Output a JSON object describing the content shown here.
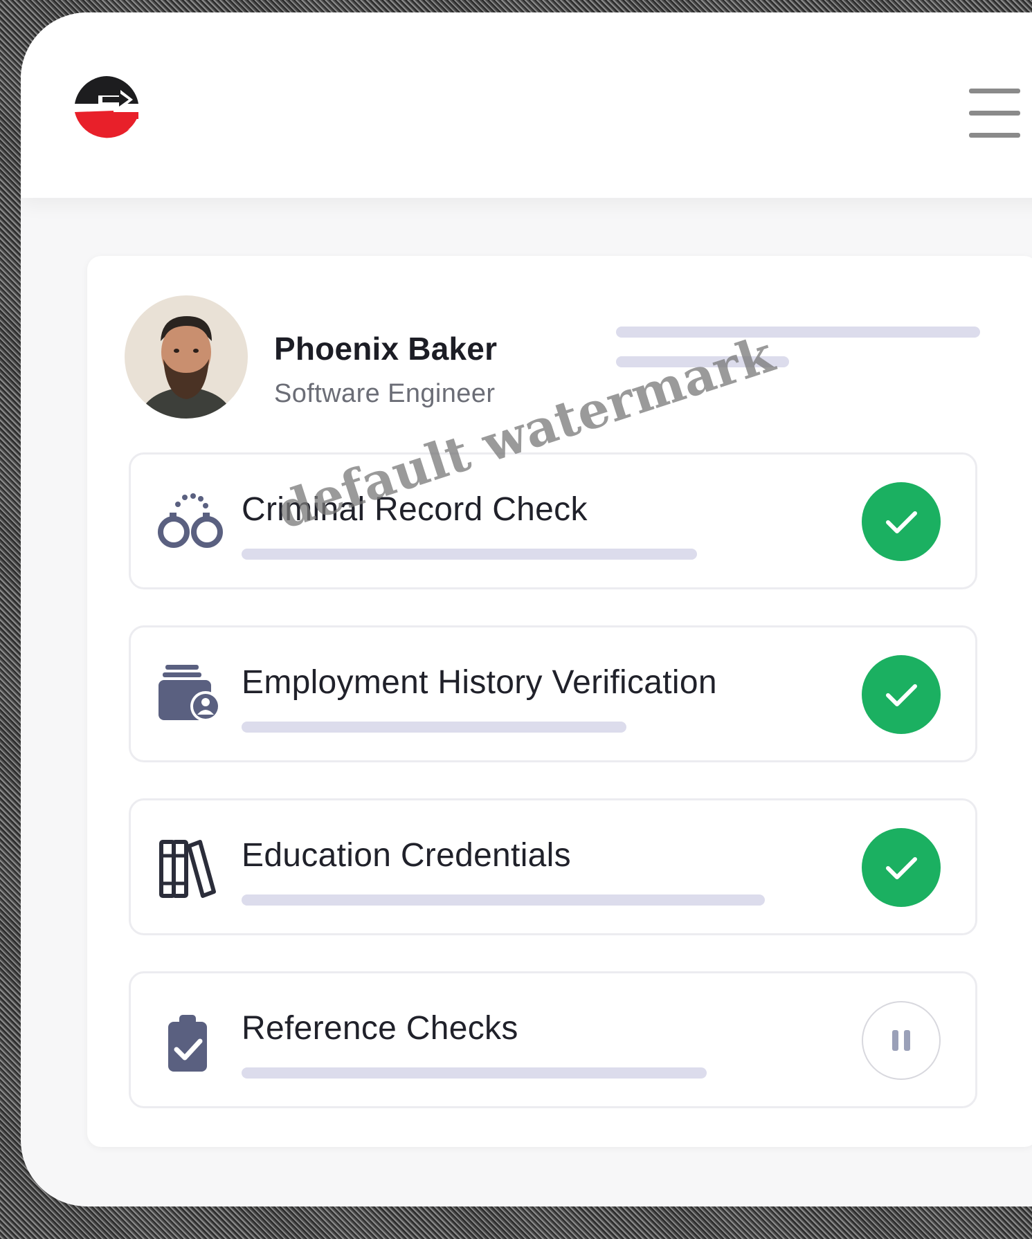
{
  "profile": {
    "name": "Phoenix Baker",
    "role": "Software Engineer"
  },
  "checks": [
    {
      "label": "Criminal Record Check",
      "icon": "handcuffs-icon",
      "status": "complete"
    },
    {
      "label": "Employment History Verification",
      "icon": "id-card-user-icon",
      "status": "complete"
    },
    {
      "label": "Education Credentials",
      "icon": "books-icon",
      "status": "complete"
    },
    {
      "label": "Reference Checks",
      "icon": "clipboard-check-icon",
      "status": "paused"
    }
  ],
  "watermark": "default watermark",
  "colors": {
    "brand_red": "#e8202a",
    "brand_dark": "#1d1d1f",
    "success": "#1bb061",
    "icon": "#5a6080",
    "placeholder_bar": "#dcdcec"
  }
}
